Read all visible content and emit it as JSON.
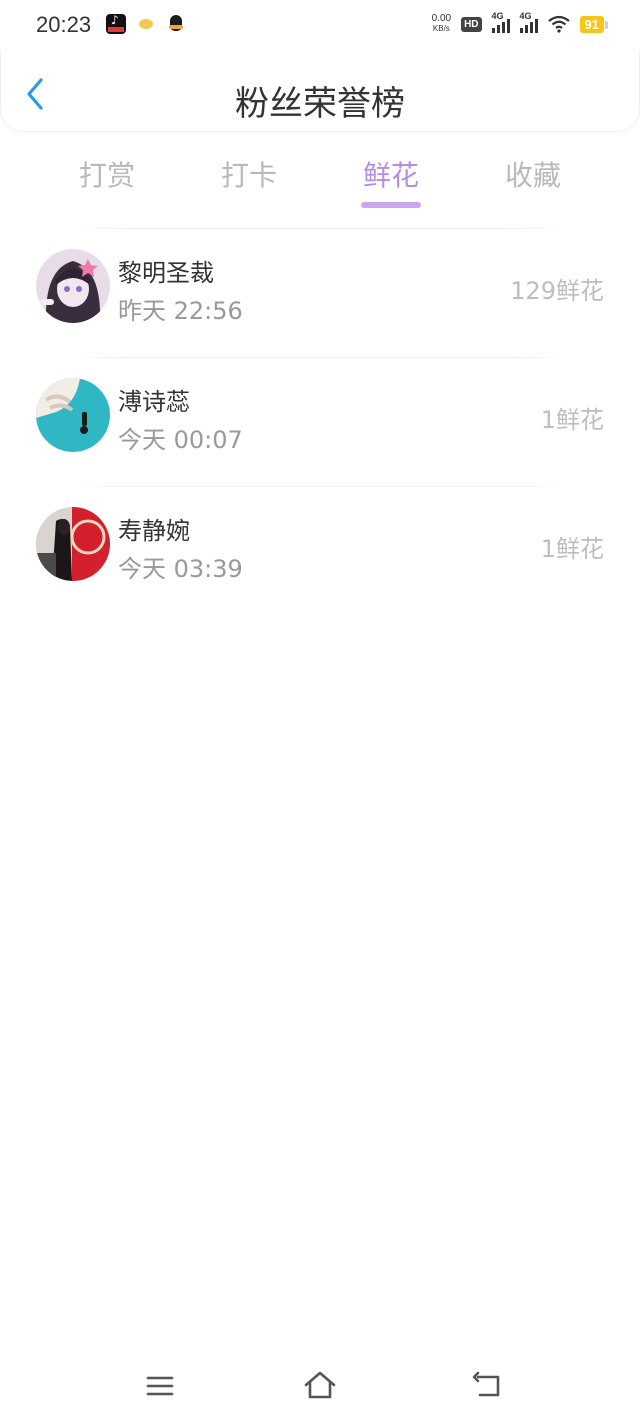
{
  "status_bar": {
    "time": "20:23",
    "net_speed_value": "0.00",
    "net_speed_unit": "KB/s",
    "hd_label": "HD",
    "sim1_label": "4G",
    "sim2_label": "4G",
    "battery": "91",
    "app_icons": [
      "tiktok-icon",
      "yellow-app-icon",
      "qq-icon"
    ]
  },
  "header": {
    "title": "粉丝荣誉榜",
    "back_icon": "chevron-left-icon"
  },
  "tabs": [
    {
      "label": "打赏",
      "active": false
    },
    {
      "label": "打卡",
      "active": false
    },
    {
      "label": "鲜花",
      "active": true
    },
    {
      "label": "收藏",
      "active": false
    }
  ],
  "rows": [
    {
      "name": "黎明圣裁",
      "time": "昨天 22:56",
      "amount": "129鲜花"
    },
    {
      "name": "溥诗蕊",
      "time": "今天 00:07",
      "amount": "1鲜花"
    },
    {
      "name": "寿静婉",
      "time": "今天 03:39",
      "amount": "1鲜花"
    }
  ],
  "colors": {
    "accent": "#b48ee0",
    "back_arrow": "#2b9be8",
    "tab_inactive": "#b9b9b9",
    "battery": "#f5c518"
  },
  "nav_bar": [
    "menu-icon",
    "home-icon",
    "back-icon"
  ]
}
